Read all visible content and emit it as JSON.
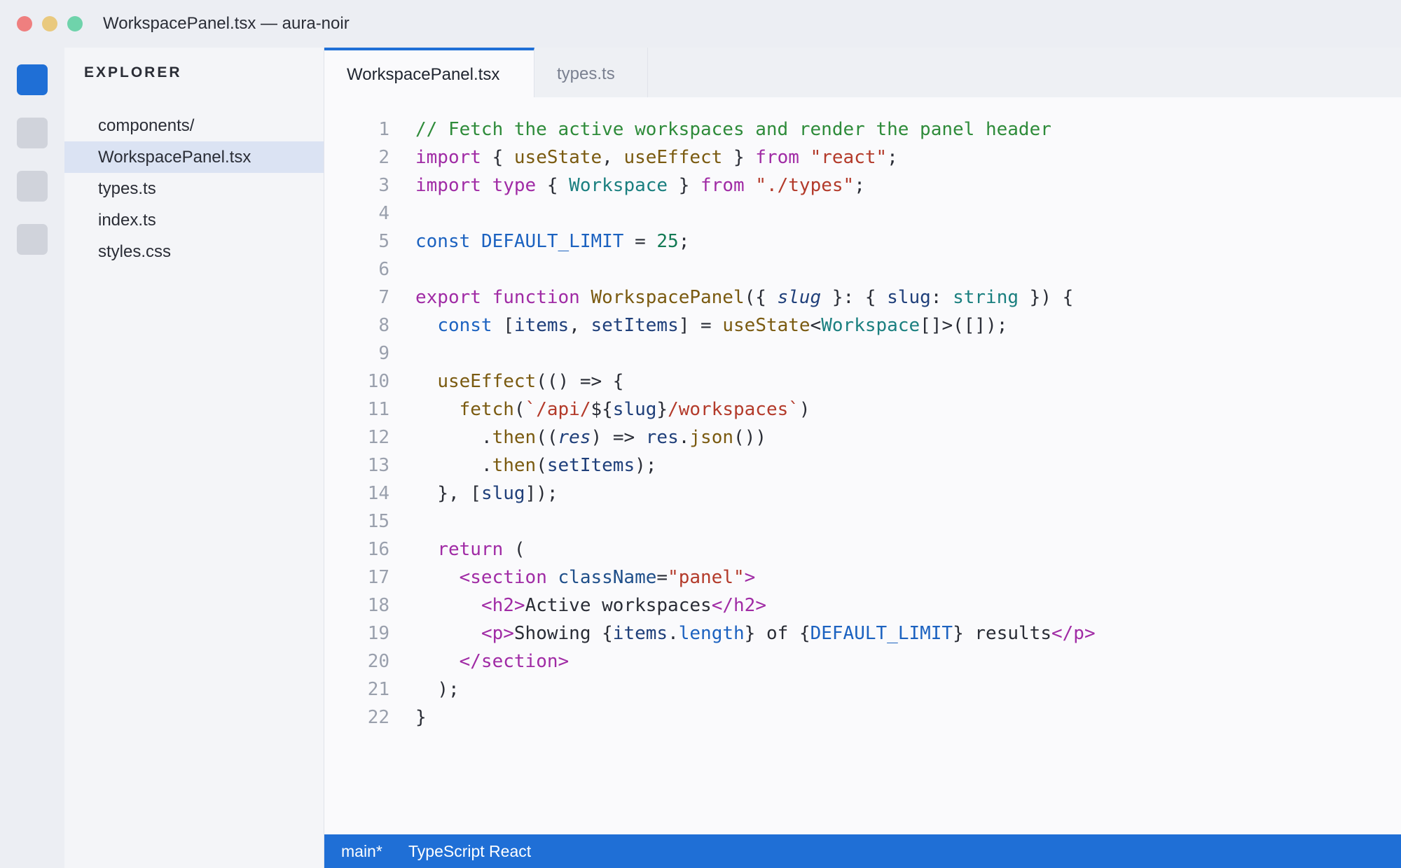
{
  "window": {
    "title": "WorkspacePanel.tsx — aura-noir"
  },
  "sidebar": {
    "title": "EXPLORER",
    "items": [
      {
        "label": "components/"
      },
      {
        "label": "WorkspacePanel.tsx"
      },
      {
        "label": "types.ts"
      },
      {
        "label": "index.ts"
      },
      {
        "label": "styles.css"
      }
    ]
  },
  "tabs": [
    {
      "label": "WorkspacePanel.tsx"
    },
    {
      "label": "types.ts"
    }
  ],
  "code": {
    "line_numbers": [
      "1",
      "2",
      "3",
      "4",
      "5",
      "6",
      "7",
      "8",
      "9",
      "10",
      "11",
      "12",
      "13",
      "14",
      "15",
      "16",
      "17",
      "18",
      "19",
      "20",
      "21",
      "22"
    ],
    "lines": [
      "// Fetch the active workspaces and render the panel header",
      "import { useState, useEffect } from \"react\";",
      "import type { Workspace } from \"./types\";",
      "",
      "const DEFAULT_LIMIT = 25;",
      "",
      "export function WorkspacePanel({ slug }: { slug: string }) {",
      "  const [items, setItems] = useState<Workspace[]>([]);",
      "",
      "  useEffect(() => {",
      "    fetch(`/api/${slug}/workspaces`)",
      "      .then((res) => res.json())",
      "      .then(setItems);",
      "  }, [slug]);",
      "",
      "  return (",
      "    <section className=\"panel\">",
      "      <h2>Active workspaces</h2>",
      "      <p>Showing {items.length} of {DEFAULT_LIMIT} results</p>",
      "    </section>",
      "  );",
      "}"
    ]
  },
  "statusbar": {
    "branch": "main*",
    "language": "TypeScript React"
  },
  "colors": {
    "accent": "#1f6fd6",
    "selection": "#dbe3f3",
    "close": "#ef7f7f",
    "minimize": "#e9c97e",
    "maximize": "#6fd3ab"
  },
  "icons": {
    "activity": [
      "explorer-icon",
      "search-icon",
      "source-control-icon",
      "extensions-icon"
    ]
  }
}
